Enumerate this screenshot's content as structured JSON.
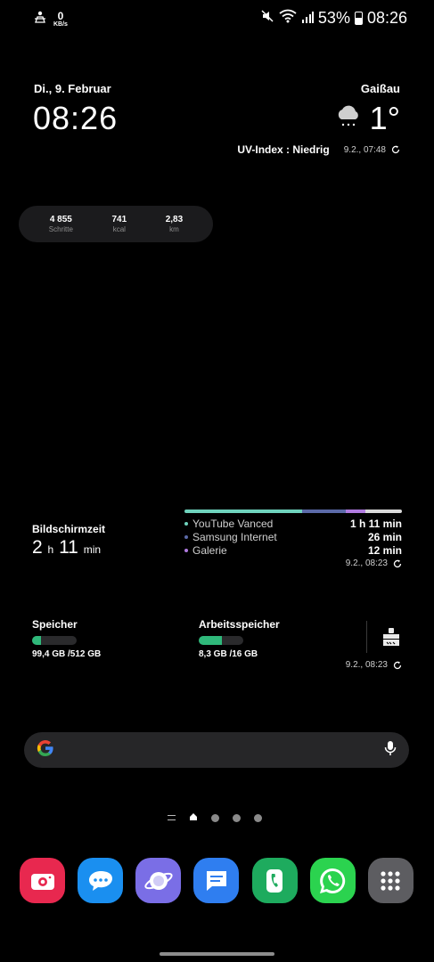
{
  "status_bar": {
    "net_speed": "0",
    "net_unit": "KB/s",
    "battery": "53%",
    "time": "08:26",
    "icons": [
      "person-icon",
      "mute-icon",
      "wifi-icon",
      "signal-icon",
      "battery-icon"
    ]
  },
  "clock_widget": {
    "date": "Di., 9. Februar",
    "time": "08:26"
  },
  "weather_widget": {
    "location": "Gaißau",
    "temperature": "1°",
    "condition_icon": "snow-cloud-icon",
    "uv": "UV-Index : Niedrig",
    "updated": "9.2., 07:48"
  },
  "health_widget": {
    "stats": [
      {
        "value": "4 855",
        "label": "Schritte"
      },
      {
        "value": "741",
        "label": "kcal"
      },
      {
        "value": "2,83",
        "label": "km"
      }
    ]
  },
  "screen_time": {
    "title": "Bildschirmzeit",
    "hours": "2",
    "hours_unit": "h",
    "minutes": "11",
    "minutes_unit": "min",
    "apps": [
      {
        "name": "YouTube Vanced",
        "time": "1 h 11 min",
        "color": "#6fd3bd",
        "share": 0.54
      },
      {
        "name": "Samsung Internet",
        "time": "26 min",
        "color": "#5b6aa8",
        "share": 0.2
      },
      {
        "name": "Galerie",
        "time": "12 min",
        "color": "#b07be0",
        "share": 0.09
      }
    ],
    "rest_color": "#d9d9d9",
    "updated": "9.2., 08:23"
  },
  "memory": {
    "storage": {
      "title": "Speicher",
      "value": "99,4 GB /512 GB",
      "fill": 0.19
    },
    "ram": {
      "title": "Arbeitsspeicher",
      "value": "8,3 GB /16 GB",
      "fill": 0.52
    },
    "updated": "9.2., 08:23"
  },
  "search": {
    "placeholder": ""
  },
  "dock": [
    {
      "name": "camera",
      "color": "#e8284f"
    },
    {
      "name": "messages",
      "color": "#1a8ff0"
    },
    {
      "name": "samsung-internet",
      "color": "#7a6ee6"
    },
    {
      "name": "samsung-notes",
      "color": "#2f7ef0"
    },
    {
      "name": "phone",
      "color": "#1eab5e"
    },
    {
      "name": "whatsapp",
      "color": "#2bd34f"
    },
    {
      "name": "app-drawer",
      "color": "#5d5d61"
    }
  ]
}
